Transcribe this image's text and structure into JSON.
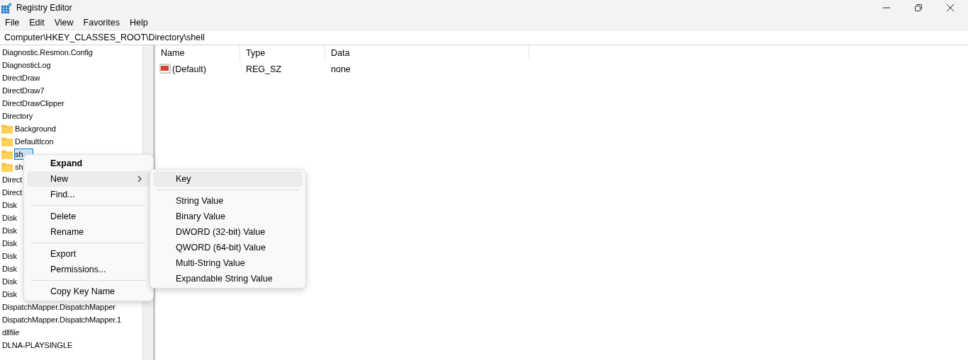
{
  "window": {
    "title": "Registry Editor"
  },
  "menu_bar": [
    "File",
    "Edit",
    "View",
    "Favorites",
    "Help"
  ],
  "address": {
    "value": "Computer\\HKEY_CLASSES_ROOT\\Directory\\shell"
  },
  "tree": {
    "items": [
      {
        "label": "Diagnostic.Resmon.Config",
        "selected": false
      },
      {
        "label": "DiagnosticLog",
        "selected": false
      },
      {
        "label": "DirectDraw",
        "selected": false
      },
      {
        "label": "DirectDraw7",
        "selected": false
      },
      {
        "label": "DirectDrawClipper",
        "selected": false
      },
      {
        "label": "Directory",
        "selected": false,
        "children": [
          {
            "label": "Background",
            "selected": false
          },
          {
            "label": "DefaultIcon",
            "selected": false
          },
          {
            "label": "sh",
            "selected": true
          },
          {
            "label": "sh",
            "selected": false
          }
        ]
      },
      {
        "label": "Direct",
        "selected": false
      },
      {
        "label": "Direct",
        "selected": false
      },
      {
        "label": "Disk",
        "selected": false
      },
      {
        "label": "Disk",
        "selected": false
      },
      {
        "label": "Disk",
        "selected": false
      },
      {
        "label": "Disk",
        "selected": false
      },
      {
        "label": "Disk",
        "selected": false
      },
      {
        "label": "Disk",
        "selected": false
      },
      {
        "label": "Disk",
        "selected": false
      },
      {
        "label": "Disk",
        "selected": false
      },
      {
        "label": "DispatchMapper.DispatchMapper",
        "selected": false
      },
      {
        "label": "DispatchMapper.DispatchMapper.1",
        "selected": false
      },
      {
        "label": "dllfile",
        "selected": false
      },
      {
        "label": "DLNA-PLAYSINGLE",
        "selected": false
      }
    ]
  },
  "values_table": {
    "columns": [
      "Name",
      "Type",
      "Data"
    ],
    "rows": [
      {
        "name": "(Default)",
        "type": "REG_SZ",
        "data": "none"
      }
    ]
  },
  "context_menu": {
    "items": [
      {
        "kind": "item",
        "label": "Expand",
        "default": true,
        "selected": false,
        "submenu": false
      },
      {
        "kind": "item",
        "label": "New",
        "default": false,
        "selected": true,
        "submenu": true
      },
      {
        "kind": "item",
        "label": "Find...",
        "default": false,
        "selected": false,
        "submenu": false
      },
      {
        "kind": "separator"
      },
      {
        "kind": "item",
        "label": "Delete",
        "default": false,
        "selected": false,
        "submenu": false
      },
      {
        "kind": "item",
        "label": "Rename",
        "default": false,
        "selected": false,
        "submenu": false
      },
      {
        "kind": "separator"
      },
      {
        "kind": "item",
        "label": "Export",
        "default": false,
        "selected": false,
        "submenu": false
      },
      {
        "kind": "item",
        "label": "Permissions...",
        "default": false,
        "selected": false,
        "submenu": false
      },
      {
        "kind": "separator"
      },
      {
        "kind": "item",
        "label": "Copy Key Name",
        "default": false,
        "selected": false,
        "submenu": false
      }
    ]
  },
  "submenu": {
    "items": [
      {
        "kind": "item",
        "label": "Key",
        "selected": true
      },
      {
        "kind": "separator"
      },
      {
        "kind": "item",
        "label": "String Value",
        "selected": false
      },
      {
        "kind": "item",
        "label": "Binary Value",
        "selected": false
      },
      {
        "kind": "item",
        "label": "DWORD (32-bit) Value",
        "selected": false
      },
      {
        "kind": "item",
        "label": "QWORD (64-bit) Value",
        "selected": false
      },
      {
        "kind": "item",
        "label": "Multi-String Value",
        "selected": false
      },
      {
        "kind": "item",
        "label": "Expandable String Value",
        "selected": false
      }
    ]
  }
}
